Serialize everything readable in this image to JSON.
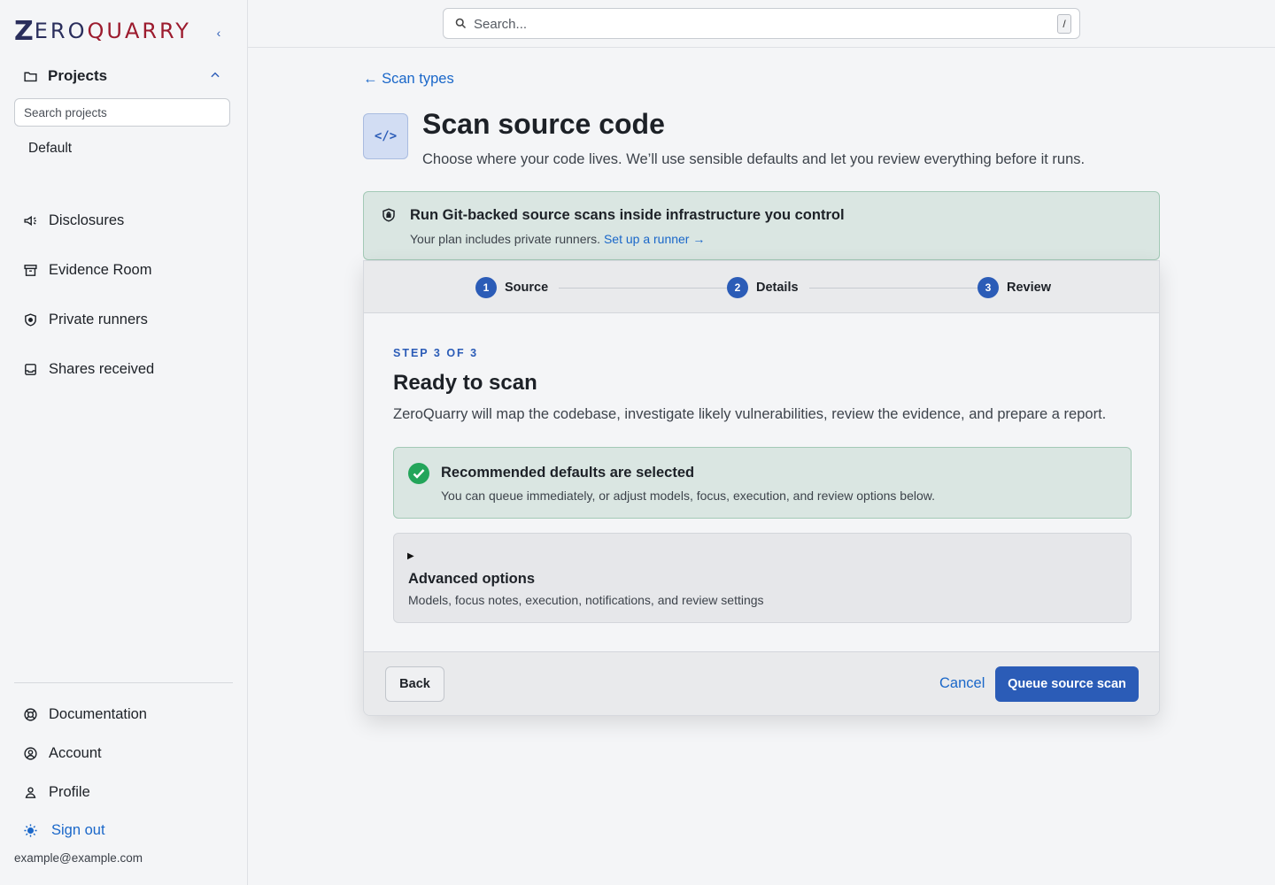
{
  "brand": {
    "logo_z": "Z",
    "logo_ero": "ERO",
    "logo_quarry": "QUARRY",
    "collapse_glyph": "‹",
    "colors": {
      "navy": "#2a2e5c",
      "crimson": "#9c1b2e"
    }
  },
  "sidebar": {
    "projects_label": "Projects",
    "search_placeholder": "Search projects",
    "project_items": [
      "Default"
    ],
    "nav": [
      {
        "label": "Disclosures",
        "icon": "megaphone-icon"
      },
      {
        "label": "Evidence Room",
        "icon": "archive-icon"
      },
      {
        "label": "Private runners",
        "icon": "shield-icon"
      },
      {
        "label": "Shares received",
        "icon": "inbox-icon"
      }
    ],
    "bottom_nav": [
      {
        "label": "Documentation",
        "icon": "lifebuoy-icon"
      },
      {
        "label": "Account",
        "icon": "user-circle-icon"
      },
      {
        "label": "Profile",
        "icon": "user-icon"
      }
    ],
    "sign_out": "Sign out",
    "email": "example@example.com"
  },
  "topbar": {
    "search_placeholder": "Search...",
    "shortcut": "/"
  },
  "main": {
    "back_link": "← Scan types",
    "icon_glyph": "</>",
    "title": "Scan source code",
    "subtitle": "Choose where your code lives. We’ll use sensible defaults and let you review everything before it runs.",
    "banner": {
      "title": "Run Git-backed source scans inside infrastructure you control",
      "text": "Your plan includes private runners.",
      "link": "Set up a runner →"
    },
    "steps": [
      {
        "num": "1",
        "label": "Source"
      },
      {
        "num": "2",
        "label": "Details"
      },
      {
        "num": "3",
        "label": "Review"
      }
    ],
    "step_label": "STEP 3 OF 3",
    "card_title": "Ready to scan",
    "card_text": "ZeroQuarry will map the codebase, investigate likely vulnerabilities, review the evidence, and prepare a report.",
    "recommended": {
      "title": "Recommended defaults are selected",
      "text": "You can queue immediately, or adjust models, focus, execution, and review options below."
    },
    "advanced": {
      "title": "Advanced options",
      "text": "Models, focus notes, execution, notifications, and review settings"
    },
    "buttons": {
      "back": "Back",
      "cancel": "Cancel",
      "queue": "Queue source scan"
    },
    "colors": {
      "accent": "#2b5cb7",
      "link": "#1a67c9",
      "success": "#23a55a"
    }
  }
}
